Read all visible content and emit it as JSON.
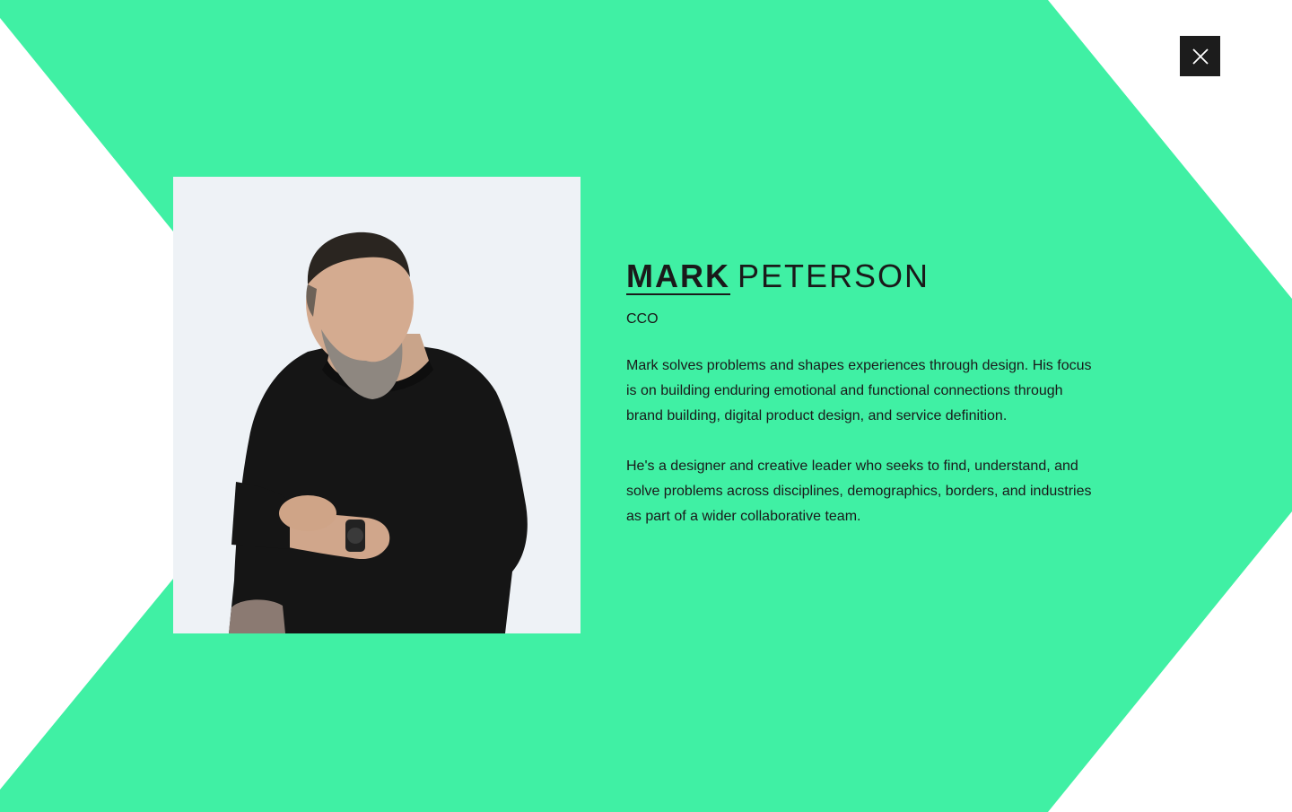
{
  "profile": {
    "first_name": "MARK",
    "last_name": "PETERSON",
    "role": "CCO",
    "bio": [
      "Mark solves problems and shapes experiences through design. His focus is on building enduring emotional and functional connections through brand building, digital product design, and service definition.",
      "He's a designer and creative leader who seeks to find, understand, and solve problems across disciplines, demographics, borders, and industries as part of a wider collaborative team."
    ]
  },
  "close_button": {
    "icon": "close-icon"
  },
  "colors": {
    "accent": "#40f0a4",
    "background": "#ffffff",
    "text": "#1a1a1a",
    "close_button_bg": "#1c1c1c"
  }
}
